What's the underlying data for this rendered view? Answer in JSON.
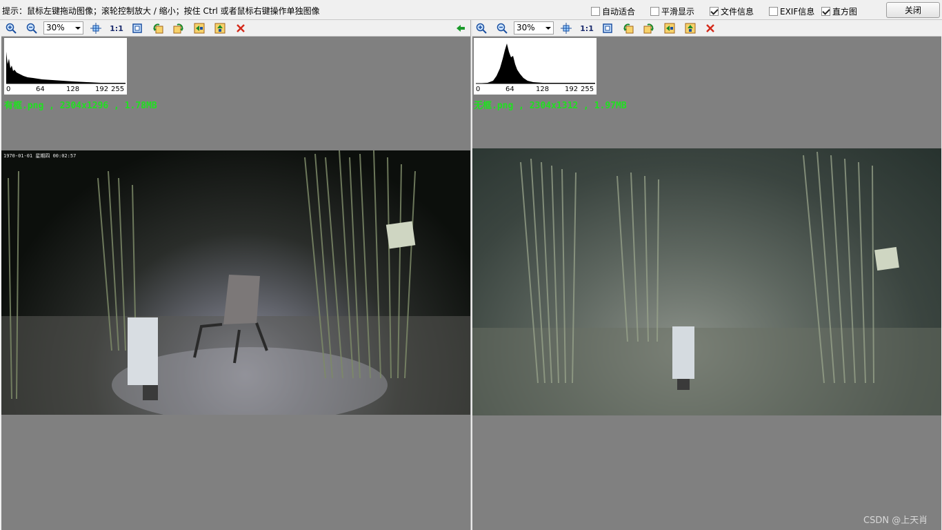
{
  "topbar": {
    "hint": "提示：鼠标左键拖动图像；滚轮控制放大 / 缩小；按住 Ctrl 或者鼠标右键操作单独图像",
    "options": [
      {
        "label": "自动适合",
        "checked": false
      },
      {
        "label": "平滑显示",
        "checked": false
      },
      {
        "label": "文件信息",
        "checked": true
      },
      {
        "label": "EXIF信息",
        "checked": false
      },
      {
        "label": "直方图",
        "checked": true
      }
    ],
    "close_label": "关闭"
  },
  "toolbar": {
    "zoom_value": "30%",
    "one_to_one": "1:1"
  },
  "histogram": {
    "tick_labels": [
      "0",
      "64",
      "128",
      "192",
      "255"
    ]
  },
  "left": {
    "file_info": "有框.png , 2304x1296 , 1.78MB",
    "timestamp": "1970-01-01 星期四 00:02:57"
  },
  "right": {
    "file_info": "无框.png , 2304x1312 , 1.97MB"
  },
  "watermark": "CSDN @上天肖"
}
